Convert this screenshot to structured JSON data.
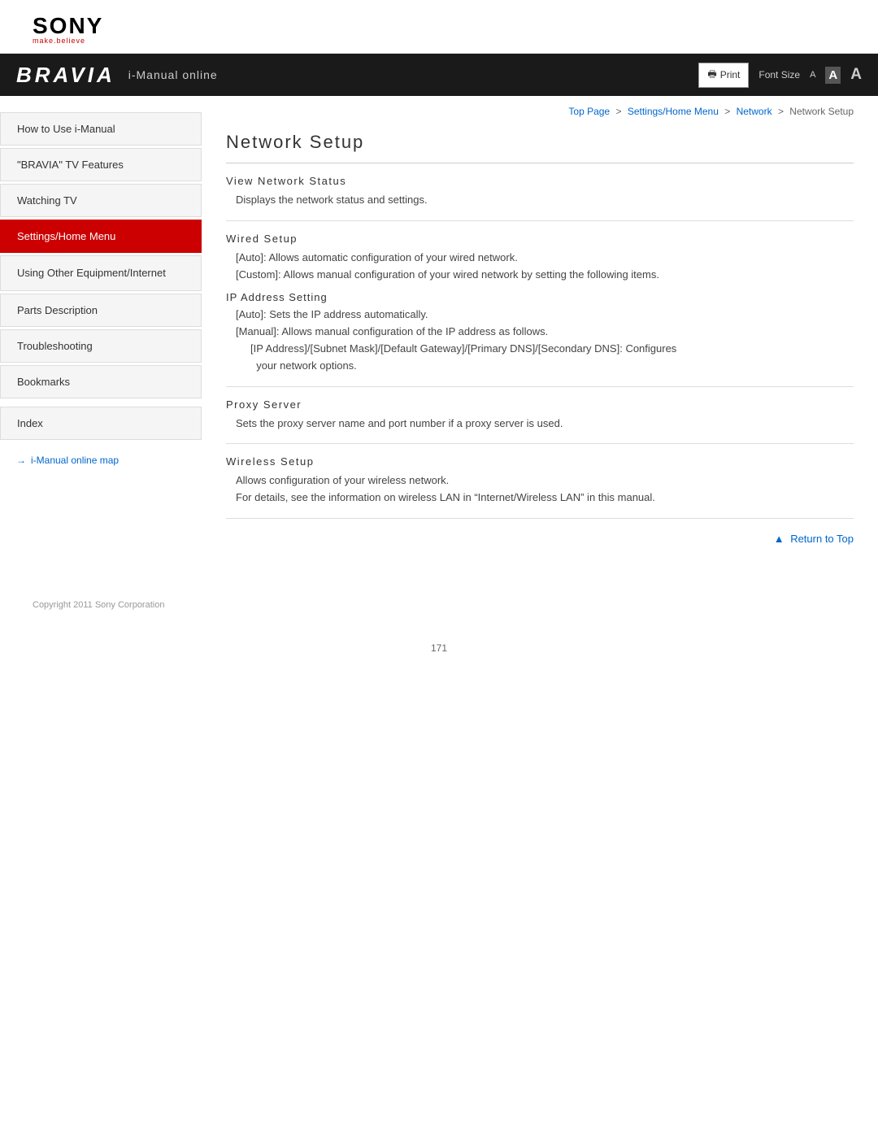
{
  "logo": {
    "sony": "SONY",
    "tagline_plain": "make.",
    "tagline_accent": "believe"
  },
  "banner": {
    "bravia": "BRAVIA",
    "imanual": "i-Manual online",
    "print_label": "Print",
    "font_size_label": "Font Size",
    "font_small": "A",
    "font_medium": "A",
    "font_large": "A"
  },
  "breadcrumb": {
    "top": "Top Page",
    "sep1": ">",
    "settings": "Settings/Home Menu",
    "sep2": ">",
    "network": "Network",
    "sep3": ">",
    "current": "Network Setup"
  },
  "sidebar": {
    "items": [
      {
        "id": "how-to-use",
        "label": "How to Use i-Manual",
        "active": false
      },
      {
        "id": "bravia-features",
        "label": "\"BRAVIA\" TV Features",
        "active": false
      },
      {
        "id": "watching-tv",
        "label": "Watching TV",
        "active": false
      },
      {
        "id": "settings-home",
        "label": "Settings/Home Menu",
        "active": true
      },
      {
        "id": "using-other",
        "label": "Using Other Equipment/Internet",
        "active": false,
        "multiline": true
      },
      {
        "id": "parts-desc",
        "label": "Parts Description",
        "active": false
      },
      {
        "id": "troubleshooting",
        "label": "Troubleshooting",
        "active": false
      },
      {
        "id": "bookmarks",
        "label": "Bookmarks",
        "active": false
      }
    ],
    "index_label": "Index",
    "map_link": "i-Manual online map"
  },
  "content": {
    "title": "Network Setup",
    "sections": [
      {
        "id": "view-network-status",
        "title": "View  Network  Status",
        "body": "Displays the network status and settings.",
        "subsections": []
      },
      {
        "id": "wired-setup",
        "title": "Wired Setup",
        "body": "",
        "subsections": [
          {
            "text": "[Auto]: Allows automatic configuration of your wired network."
          },
          {
            "text": "[Custom]: Allows manual configuration of your wired network by setting the following items."
          }
        ],
        "sub": [
          {
            "id": "ip-address",
            "title": "IP  Address  Setting",
            "lines": [
              "[Auto]: Sets the IP address automatically.",
              "[Manual]: Allows manual configuration of the IP address as follows.",
              "[IP Address]/[Subnet Mask]/[Default Gateway]/[Primary DNS]/[Secondary DNS]: Configures your network options."
            ]
          }
        ]
      },
      {
        "id": "proxy-server",
        "title": "Proxy  Server",
        "body": "Sets the proxy server name and port number if a proxy server is used.",
        "subsections": []
      },
      {
        "id": "wireless-setup",
        "title": "Wireless  Setup",
        "body": "",
        "subsections": [
          {
            "text": "Allows configuration of your wireless network."
          },
          {
            "text": "For details, see the information on wireless LAN in “Internet/Wireless LAN” in this manual."
          }
        ]
      }
    ],
    "return_to_top": "Return to Top"
  },
  "footer": {
    "copyright": "Copyright 2011 Sony Corporation"
  },
  "page_number": "171"
}
